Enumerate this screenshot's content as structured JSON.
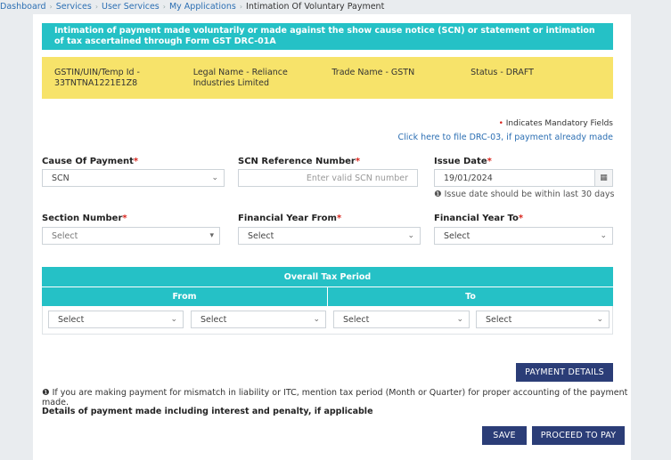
{
  "breadcrumb": {
    "items": [
      "Dashboard",
      "Services",
      "User Services",
      "My Applications"
    ],
    "current": "Intimation Of Voluntary Payment"
  },
  "banner": {
    "text": "Intimation of payment made voluntarily or made against the show cause notice (SCN) or statement or intimation of tax ascertained through Form GST DRC-01A"
  },
  "info": {
    "gstin": "GSTIN/UIN/Temp Id - 33TNTNA1221E1Z8",
    "legal_name": "Legal Name - Reliance Industries Limited",
    "trade_name": "Trade Name - GSTN",
    "status": "Status - DRAFT"
  },
  "mandatory_note": "Indicates Mandatory Fields",
  "drc_link": "Click here to file DRC-03, if payment already made",
  "form": {
    "cause_label": "Cause Of Payment",
    "cause_value": "SCN",
    "scn_label": "SCN Reference Number",
    "scn_placeholder": "Enter valid SCN number",
    "issue_label": "Issue Date",
    "issue_value": "19/01/2024",
    "issue_hint": "Issue date should be within last 30 days",
    "section_label": "Section Number",
    "section_value": "Select",
    "fy_from_label": "Financial Year From",
    "fy_from_value": "Select",
    "fy_to_label": "Financial Year To",
    "fy_to_value": "Select"
  },
  "period": {
    "title": "Overall Tax Period",
    "from": "From",
    "to": "To",
    "selects": [
      "Select",
      "Select",
      "Select",
      "Select"
    ]
  },
  "buttons": {
    "payment_details": "PAYMENT DETAILS",
    "save": "SAVE",
    "proceed": "PROCEED TO PAY"
  },
  "note": "If you are making payment for mismatch in liability or ITC, mention tax period (Month or Quarter) for proper accounting of the payment made.",
  "details_heading": "Details of payment made including interest and penalty, if applicable",
  "colors": {
    "teal": "#25c1c6",
    "yellow": "#f7e36a",
    "navy": "#2b3d77",
    "required": "#d9251d",
    "link": "#2c6fb3"
  }
}
